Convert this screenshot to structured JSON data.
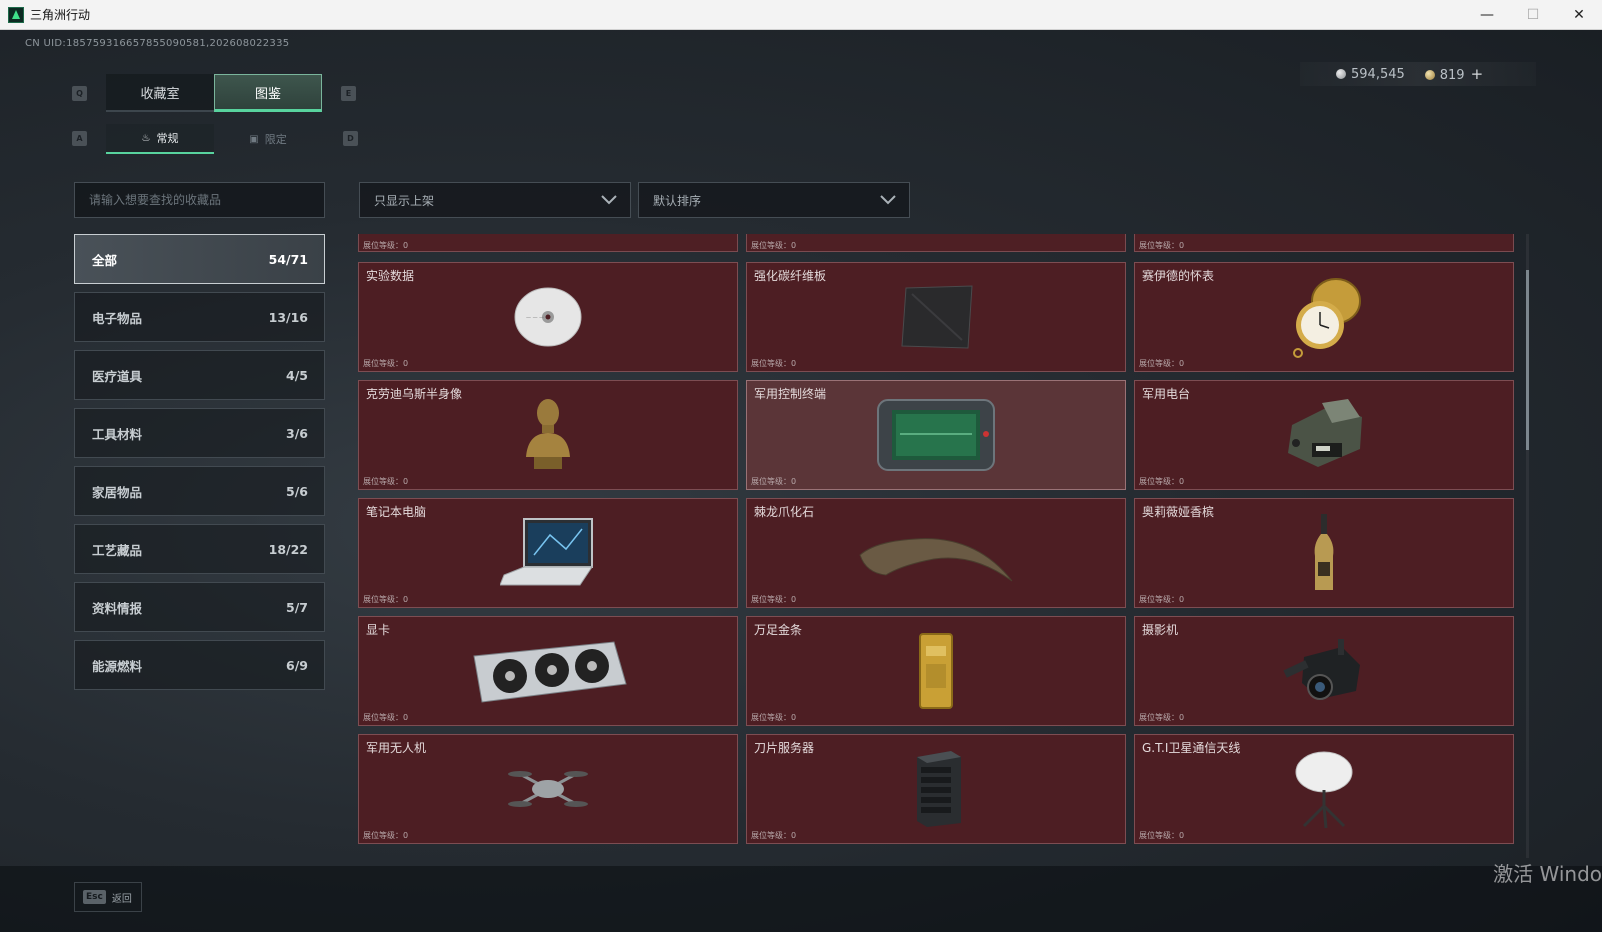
{
  "window": {
    "title": "三角洲行动",
    "minimize": "—",
    "maximize": "☐",
    "close": "✕"
  },
  "uid": "CN UID:18575931665785509058‌1,2026080223‌35",
  "currency": {
    "silver": "594,545",
    "gold": "819",
    "add": "+"
  },
  "keys": {
    "prev_tab": "Q",
    "next_tab": "E",
    "prev_sub": "A",
    "next_sub": "D"
  },
  "tabs": [
    {
      "label": "收藏室"
    },
    {
      "label": "图鉴"
    }
  ],
  "subtabs": [
    {
      "label": "常规"
    },
    {
      "label": "限定"
    }
  ],
  "search": {
    "placeholder": "请输入想要查找的收藏品"
  },
  "filters": {
    "display": "只显示上架",
    "sort": "默认排序"
  },
  "categories": [
    {
      "label": "全部",
      "count": "54/71"
    },
    {
      "label": "电子物品",
      "count": "13/16"
    },
    {
      "label": "医疗道具",
      "count": "4/5"
    },
    {
      "label": "工具材料",
      "count": "3/6"
    },
    {
      "label": "家居物品",
      "count": "5/6"
    },
    {
      "label": "工艺藏品",
      "count": "18/22"
    },
    {
      "label": "资料情报",
      "count": "5/7"
    },
    {
      "label": "能源燃料",
      "count": "6/9"
    }
  ],
  "level_label": "展位等级：0",
  "items": [
    {
      "name": "实验数据",
      "icon": "disc-icon"
    },
    {
      "name": "强化碳纤维板",
      "icon": "carbon-plate-icon"
    },
    {
      "name": "赛伊德的怀表",
      "icon": "pocket-watch-icon"
    },
    {
      "name": "克劳迪乌斯半身像",
      "icon": "bust-icon"
    },
    {
      "name": "军用控制终端",
      "icon": "control-terminal-icon"
    },
    {
      "name": "军用电台",
      "icon": "radio-icon"
    },
    {
      "name": "笔记本电脑",
      "icon": "laptop-icon"
    },
    {
      "name": "棘龙爪化石",
      "icon": "claw-fossil-icon"
    },
    {
      "name": "奥莉薇娅香槟",
      "icon": "champagne-icon"
    },
    {
      "name": "显卡",
      "icon": "gpu-icon"
    },
    {
      "name": "万足金条",
      "icon": "gold-bar-icon"
    },
    {
      "name": "摄影机",
      "icon": "camera-icon"
    },
    {
      "name": "军用无人机",
      "icon": "drone-icon"
    },
    {
      "name": "刀片服务器",
      "icon": "server-icon"
    },
    {
      "name": "G.T.I卫星通信天线",
      "icon": "satellite-dish-icon"
    }
  ],
  "footer": {
    "esc_key": "Esc",
    "esc_label": "返回"
  },
  "watermark": "激活 Windo"
}
